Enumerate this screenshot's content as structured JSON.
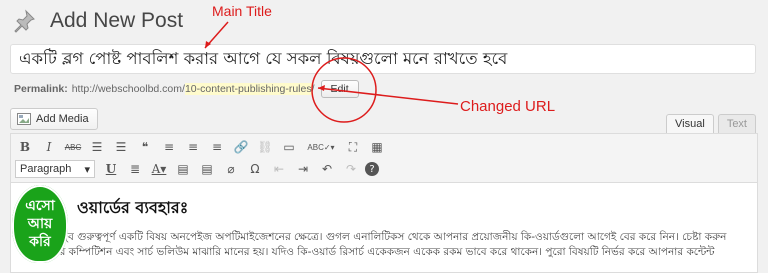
{
  "header": {
    "title": "Add New Post",
    "icon": "pushpin-icon"
  },
  "annotations": {
    "main_title": "Main Title",
    "changed_url": "Changed URL",
    "color": "#dd1c1c"
  },
  "post": {
    "title_value": "একটি ব্লগ পোষ্ট পাবলিশ করার আগে যে সকল বিষয়গুলো মনে রাখতে হবে"
  },
  "permalink": {
    "label": "Permalink:",
    "base": "http://webschoolbd.com/",
    "slug": "10-content-publishing-rules",
    "suffix": "/",
    "edit_label": "Edit"
  },
  "media": {
    "add_media_label": "Add Media"
  },
  "editor_tabs": {
    "visual": "Visual",
    "text": "Text"
  },
  "toolbar": {
    "row1": [
      "B",
      "I",
      "ABC",
      "☰",
      "☰",
      "❝",
      "≡",
      "≡",
      "≡",
      "🔗",
      "⛓",
      "▭",
      "ABC✓▾",
      "⛶",
      "▦"
    ],
    "format_select": "Paragraph",
    "row2": [
      "U",
      "≣",
      "A▾",
      "▤",
      "▤",
      "⌀",
      "Ω",
      "⇤",
      "⇥",
      "↶",
      "↷",
      "?"
    ]
  },
  "content": {
    "heading": "ওয়ার্ডের ব্যবহারঃ",
    "para1": "কি-ওয়ার্ড খুব গুরুত্বপূর্ণ একটি বিষয় অনপেইজ অপটিমাইজেশনের ক্ষেত্রে। গুগল এনালিটিকস থেকে আপনার প্রয়োজনীয় কি-ওয়ার্ডগুলো আগেই বের করে নিন। চেষ্টা করুন",
    "para2": "যেন তাদের কম্পিটিশন এবং সার্চ ভলিউম মাঝারি মানের হয়। যদিও কি-ওয়ার্ড রিসার্চ একেকজন একেক রকম ভাবে করে থাকেন। পুরো বিষয়টি নির্ভর করে আপনার কন্টেন্ট"
  },
  "badge": {
    "line1": "এসো",
    "line2": "আয়",
    "line3": "করি",
    "color": "#1aa31a"
  }
}
